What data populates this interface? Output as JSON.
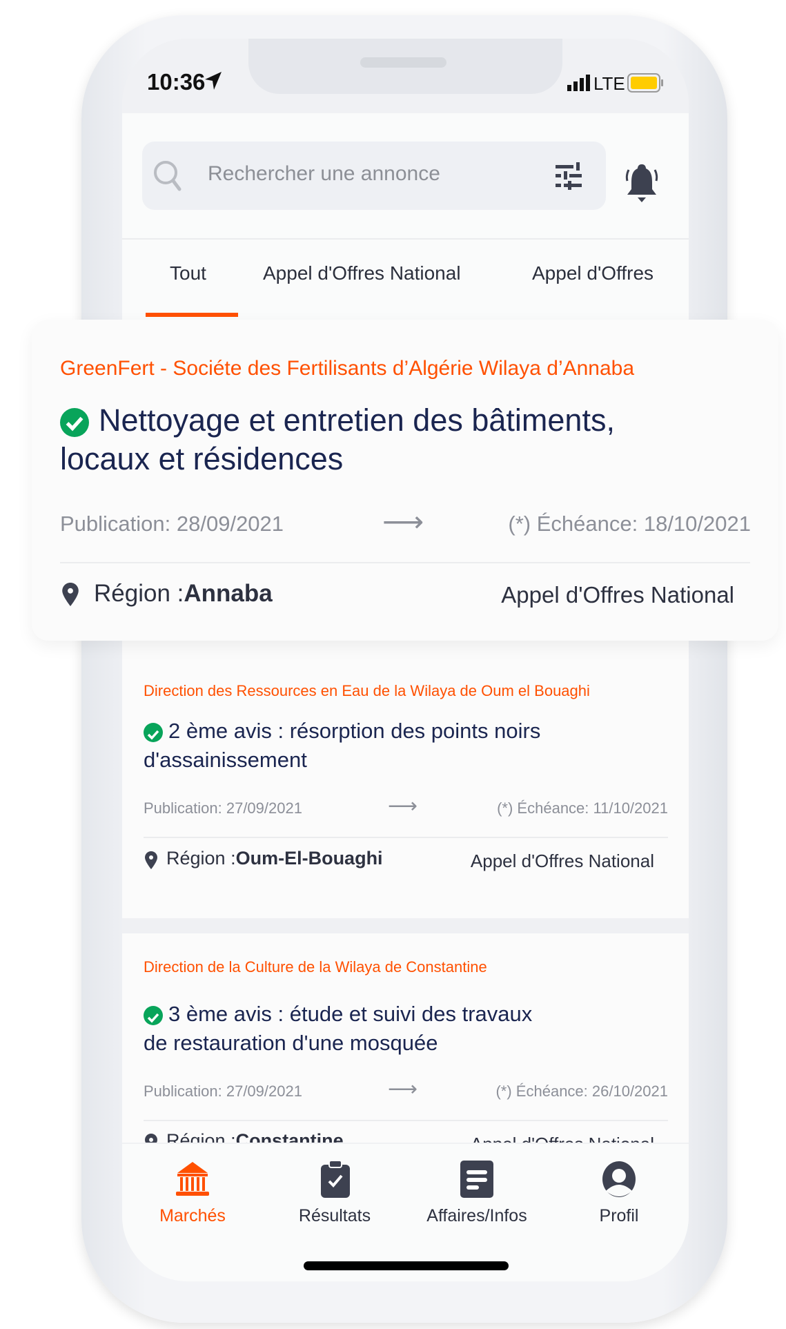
{
  "status_bar": {
    "time": "10:36",
    "network": "LTE",
    "battery_color": "#ffcc00"
  },
  "search": {
    "placeholder": "Rechercher une annonce"
  },
  "tabs": [
    {
      "label": "Tout",
      "active": true
    },
    {
      "label": "Appel d'Offres National"
    },
    {
      "label": "Appel d'Offres"
    }
  ],
  "colors": {
    "accent": "#ff5000",
    "title": "#1a2550",
    "verified": "#08a45a"
  },
  "listings": [
    {
      "org": "GreenFert - Sociéte des Fertilisants d’Algérie Wilaya d’Annaba",
      "title_line1": "Nettoyage et entretien des bâtiments,",
      "title_line2": "locaux et résidences",
      "publication": "Publication: 28/09/2021",
      "deadline": "(*) Échéance: 18/10/2021",
      "region_label": "Région :",
      "region": "Annaba",
      "type": "Appel d'Offres National"
    },
    {
      "org": "Direction des Ressources en Eau de la Wilaya de Oum el Bouaghi",
      "title_line1": "2 ème avis :  résorption des points noirs",
      "title_line2": "d'assainissement",
      "publication": "Publication: 27/09/2021",
      "deadline": "(*) Échéance: 11/10/2021",
      "region_label": "Région :",
      "region": "Oum-El-Bouaghi",
      "type": "Appel d'Offres National"
    },
    {
      "org": "Direction de la Culture de la Wilaya de Constantine",
      "title_line1": "3 ème avis : étude et suivi des travaux",
      "title_line2": "de restauration d'une  mosquée",
      "publication": "Publication: 27/09/2021",
      "deadline": "(*) Échéance: 26/10/2021",
      "region_label": "Région :",
      "region": "Constantine",
      "type": "Appel d'Offres National"
    }
  ],
  "bottom_nav": [
    {
      "label": "Marchés",
      "icon": "bank-icon",
      "active": true
    },
    {
      "label": "Résultats",
      "icon": "clipboard-check-icon"
    },
    {
      "label": "Affaires/Infos",
      "icon": "document-icon"
    },
    {
      "label": "Profil",
      "icon": "user-icon"
    }
  ]
}
